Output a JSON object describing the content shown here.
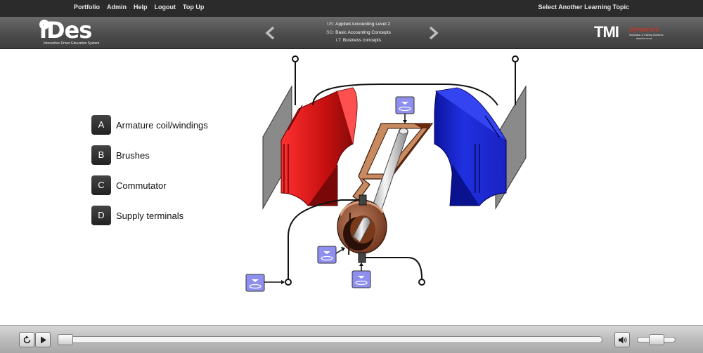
{
  "nav": {
    "links": [
      "Portfolio",
      "Admin",
      "Help",
      "Logout",
      "Top Up"
    ],
    "right_link": "Select Another Learning Topic"
  },
  "logo": {
    "text": "iDes",
    "subtitle": "Interactive Driver Education System"
  },
  "breadcrumbs": [
    {
      "key": "US:",
      "value": "Applied Accounting Level 2"
    },
    {
      "key": "SO:",
      "value": "Basic Accounting Concepts"
    },
    {
      "key": "LT:",
      "value": "Business concepts"
    }
  ],
  "brand": {
    "big": "TMI",
    "red": "Dynamics",
    "line1": "Simulation & Training Solutions",
    "line2": "www.tmi.co.za"
  },
  "legend": [
    {
      "letter": "A",
      "label": "Armature coil/windings"
    },
    {
      "letter": "B",
      "label": "Brushes"
    },
    {
      "letter": "C",
      "label": "Commutator"
    },
    {
      "letter": "D",
      "label": "Supply terminals"
    }
  ],
  "colors": {
    "north_pole": "#d01818",
    "south_pole": "#1a28c8",
    "drop_target": "#8f8ff0",
    "copper": "#8a4a2a",
    "topbar": "#2b2b2b"
  },
  "player": {
    "progress": 0.0,
    "volume": 0.5
  }
}
